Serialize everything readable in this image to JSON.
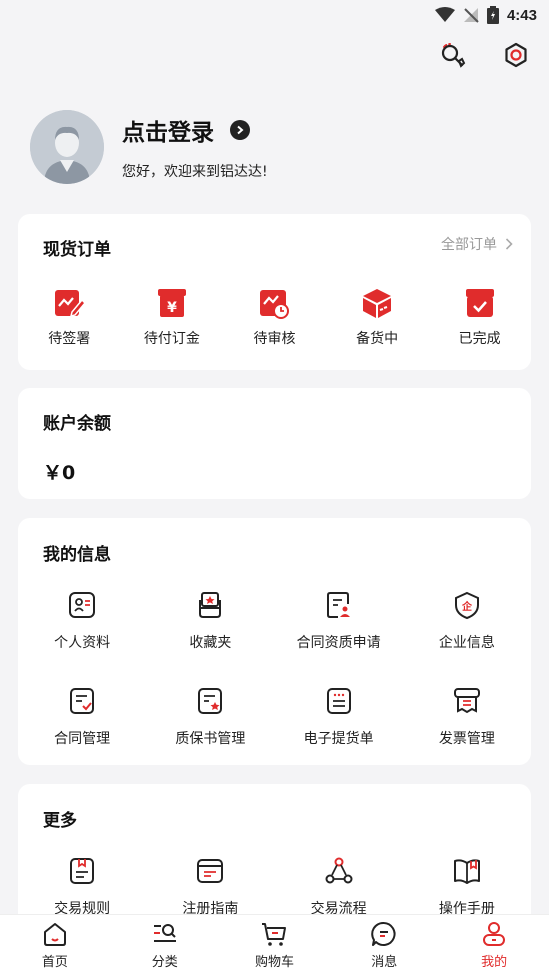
{
  "status_bar": {
    "time": "4:43"
  },
  "profile": {
    "login_text": "点击登录",
    "welcome_text": "您好，欢迎来到铝达达!"
  },
  "orders": {
    "title": "现货订单",
    "all_orders_label": "全部订单",
    "items": [
      {
        "label": "待签署",
        "icon": "sign-edit-icon"
      },
      {
        "label": "待付订金",
        "icon": "deposit-yen-icon"
      },
      {
        "label": "待审核",
        "icon": "review-clock-icon"
      },
      {
        "label": "备货中",
        "icon": "stocking-box-icon"
      },
      {
        "label": "已完成",
        "icon": "completed-check-icon"
      }
    ]
  },
  "balance": {
    "title": "账户余额",
    "value": "￥0"
  },
  "my_info": {
    "title": "我的信息",
    "items": [
      {
        "label": "个人资料",
        "icon": "profile-card-icon"
      },
      {
        "label": "收藏夹",
        "icon": "favorites-icon"
      },
      {
        "label": "合同资质申请",
        "icon": "contract-apply-icon"
      },
      {
        "label": "企业信息",
        "icon": "enterprise-shield-icon"
      },
      {
        "label": "合同管理",
        "icon": "contract-manage-icon"
      },
      {
        "label": "质保书管理",
        "icon": "warranty-icon"
      },
      {
        "label": "电子提货单",
        "icon": "e-delivery-icon"
      },
      {
        "label": "发票管理",
        "icon": "invoice-icon"
      }
    ]
  },
  "more": {
    "title": "更多",
    "items": [
      {
        "label": "交易规则",
        "icon": "trade-rules-icon"
      },
      {
        "label": "注册指南",
        "icon": "register-guide-icon"
      },
      {
        "label": "交易流程",
        "icon": "trade-flow-icon"
      },
      {
        "label": "操作手册",
        "icon": "manual-book-icon"
      }
    ]
  },
  "bottom_nav": {
    "items": [
      {
        "label": "首页",
        "icon": "home-icon"
      },
      {
        "label": "分类",
        "icon": "category-icon"
      },
      {
        "label": "购物车",
        "icon": "cart-icon"
      },
      {
        "label": "消息",
        "icon": "message-icon"
      },
      {
        "label": "我的",
        "icon": "user-icon",
        "active": true
      }
    ]
  },
  "colors": {
    "accent": "#e02c2c",
    "background": "#f4f4f6",
    "card": "#ffffff"
  }
}
